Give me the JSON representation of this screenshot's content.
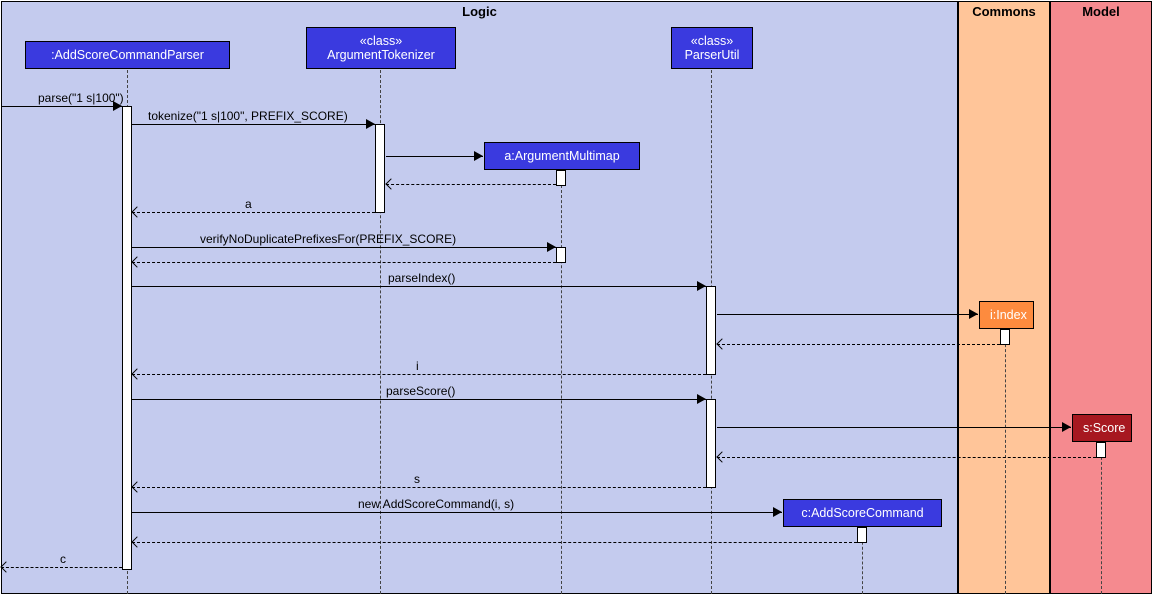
{
  "packages": {
    "logic": "Logic",
    "commons": "Commons",
    "model": "Model"
  },
  "participants": {
    "parser": ":AddScoreCommandParser",
    "tokenizer_stereotype": "«class»",
    "tokenizer": "ArgumentTokenizer",
    "parserutil_stereotype": "«class»",
    "parserutil": "ParserUtil",
    "multimap": "a:ArgumentMultimap",
    "command": "c:AddScoreCommand",
    "index": "i:Index",
    "score": "s:Score"
  },
  "messages": {
    "m1": "parse(\"1 s|100\")",
    "m2": "tokenize(\"1 s|100\", PREFIX_SCORE)",
    "m3": "a",
    "m4": "verifyNoDuplicatePrefixesFor(PREFIX_SCORE)",
    "m5": "parseIndex()",
    "m6": "i",
    "m7": "parseScore()",
    "m8": "s",
    "m9": "new AddScoreCommand(i, s)",
    "m10": "c"
  },
  "chart_data": {
    "type": "sequence-diagram",
    "packages": [
      {
        "name": "Logic",
        "participants": [
          "AddScoreCommandParser",
          "ArgumentTokenizer",
          "ParserUtil",
          "ArgumentMultimap",
          "AddScoreCommand"
        ]
      },
      {
        "name": "Commons",
        "participants": [
          "Index"
        ]
      },
      {
        "name": "Model",
        "participants": [
          "Score"
        ]
      }
    ],
    "participants": [
      {
        "id": "parser",
        "label": ":AddScoreCommandParser",
        "type": "object"
      },
      {
        "id": "tokenizer",
        "label": "ArgumentTokenizer",
        "type": "class"
      },
      {
        "id": "parserutil",
        "label": "ParserUtil",
        "type": "class"
      },
      {
        "id": "multimap",
        "label": "a:ArgumentMultimap",
        "type": "object",
        "created": true
      },
      {
        "id": "command",
        "label": "c:AddScoreCommand",
        "type": "object",
        "created": true
      },
      {
        "id": "index",
        "label": "i:Index",
        "type": "object",
        "created": true
      },
      {
        "id": "score",
        "label": "s:Score",
        "type": "object",
        "created": true
      }
    ],
    "interactions": [
      {
        "from": "caller",
        "to": "parser",
        "label": "parse(\"1 s|100\")",
        "kind": "call"
      },
      {
        "from": "parser",
        "to": "tokenizer",
        "label": "tokenize(\"1 s|100\", PREFIX_SCORE)",
        "kind": "call"
      },
      {
        "from": "tokenizer",
        "to": "multimap",
        "label": "",
        "kind": "create"
      },
      {
        "from": "multimap",
        "to": "tokenizer",
        "label": "",
        "kind": "return"
      },
      {
        "from": "tokenizer",
        "to": "parser",
        "label": "a",
        "kind": "return"
      },
      {
        "from": "parser",
        "to": "multimap",
        "label": "verifyNoDuplicatePrefixesFor(PREFIX_SCORE)",
        "kind": "call"
      },
      {
        "from": "multimap",
        "to": "parser",
        "label": "",
        "kind": "return"
      },
      {
        "from": "parser",
        "to": "parserutil",
        "label": "parseIndex()",
        "kind": "call"
      },
      {
        "from": "parserutil",
        "to": "index",
        "label": "",
        "kind": "create"
      },
      {
        "from": "index",
        "to": "parserutil",
        "label": "",
        "kind": "return"
      },
      {
        "from": "parserutil",
        "to": "parser",
        "label": "i",
        "kind": "return"
      },
      {
        "from": "parser",
        "to": "parserutil",
        "label": "parseScore()",
        "kind": "call"
      },
      {
        "from": "parserutil",
        "to": "score",
        "label": "",
        "kind": "create"
      },
      {
        "from": "score",
        "to": "parserutil",
        "label": "",
        "kind": "return"
      },
      {
        "from": "parserutil",
        "to": "parser",
        "label": "s",
        "kind": "return"
      },
      {
        "from": "parser",
        "to": "command",
        "label": "new AddScoreCommand(i, s)",
        "kind": "create"
      },
      {
        "from": "command",
        "to": "parser",
        "label": "",
        "kind": "return"
      },
      {
        "from": "parser",
        "to": "caller",
        "label": "c",
        "kind": "return"
      }
    ]
  }
}
